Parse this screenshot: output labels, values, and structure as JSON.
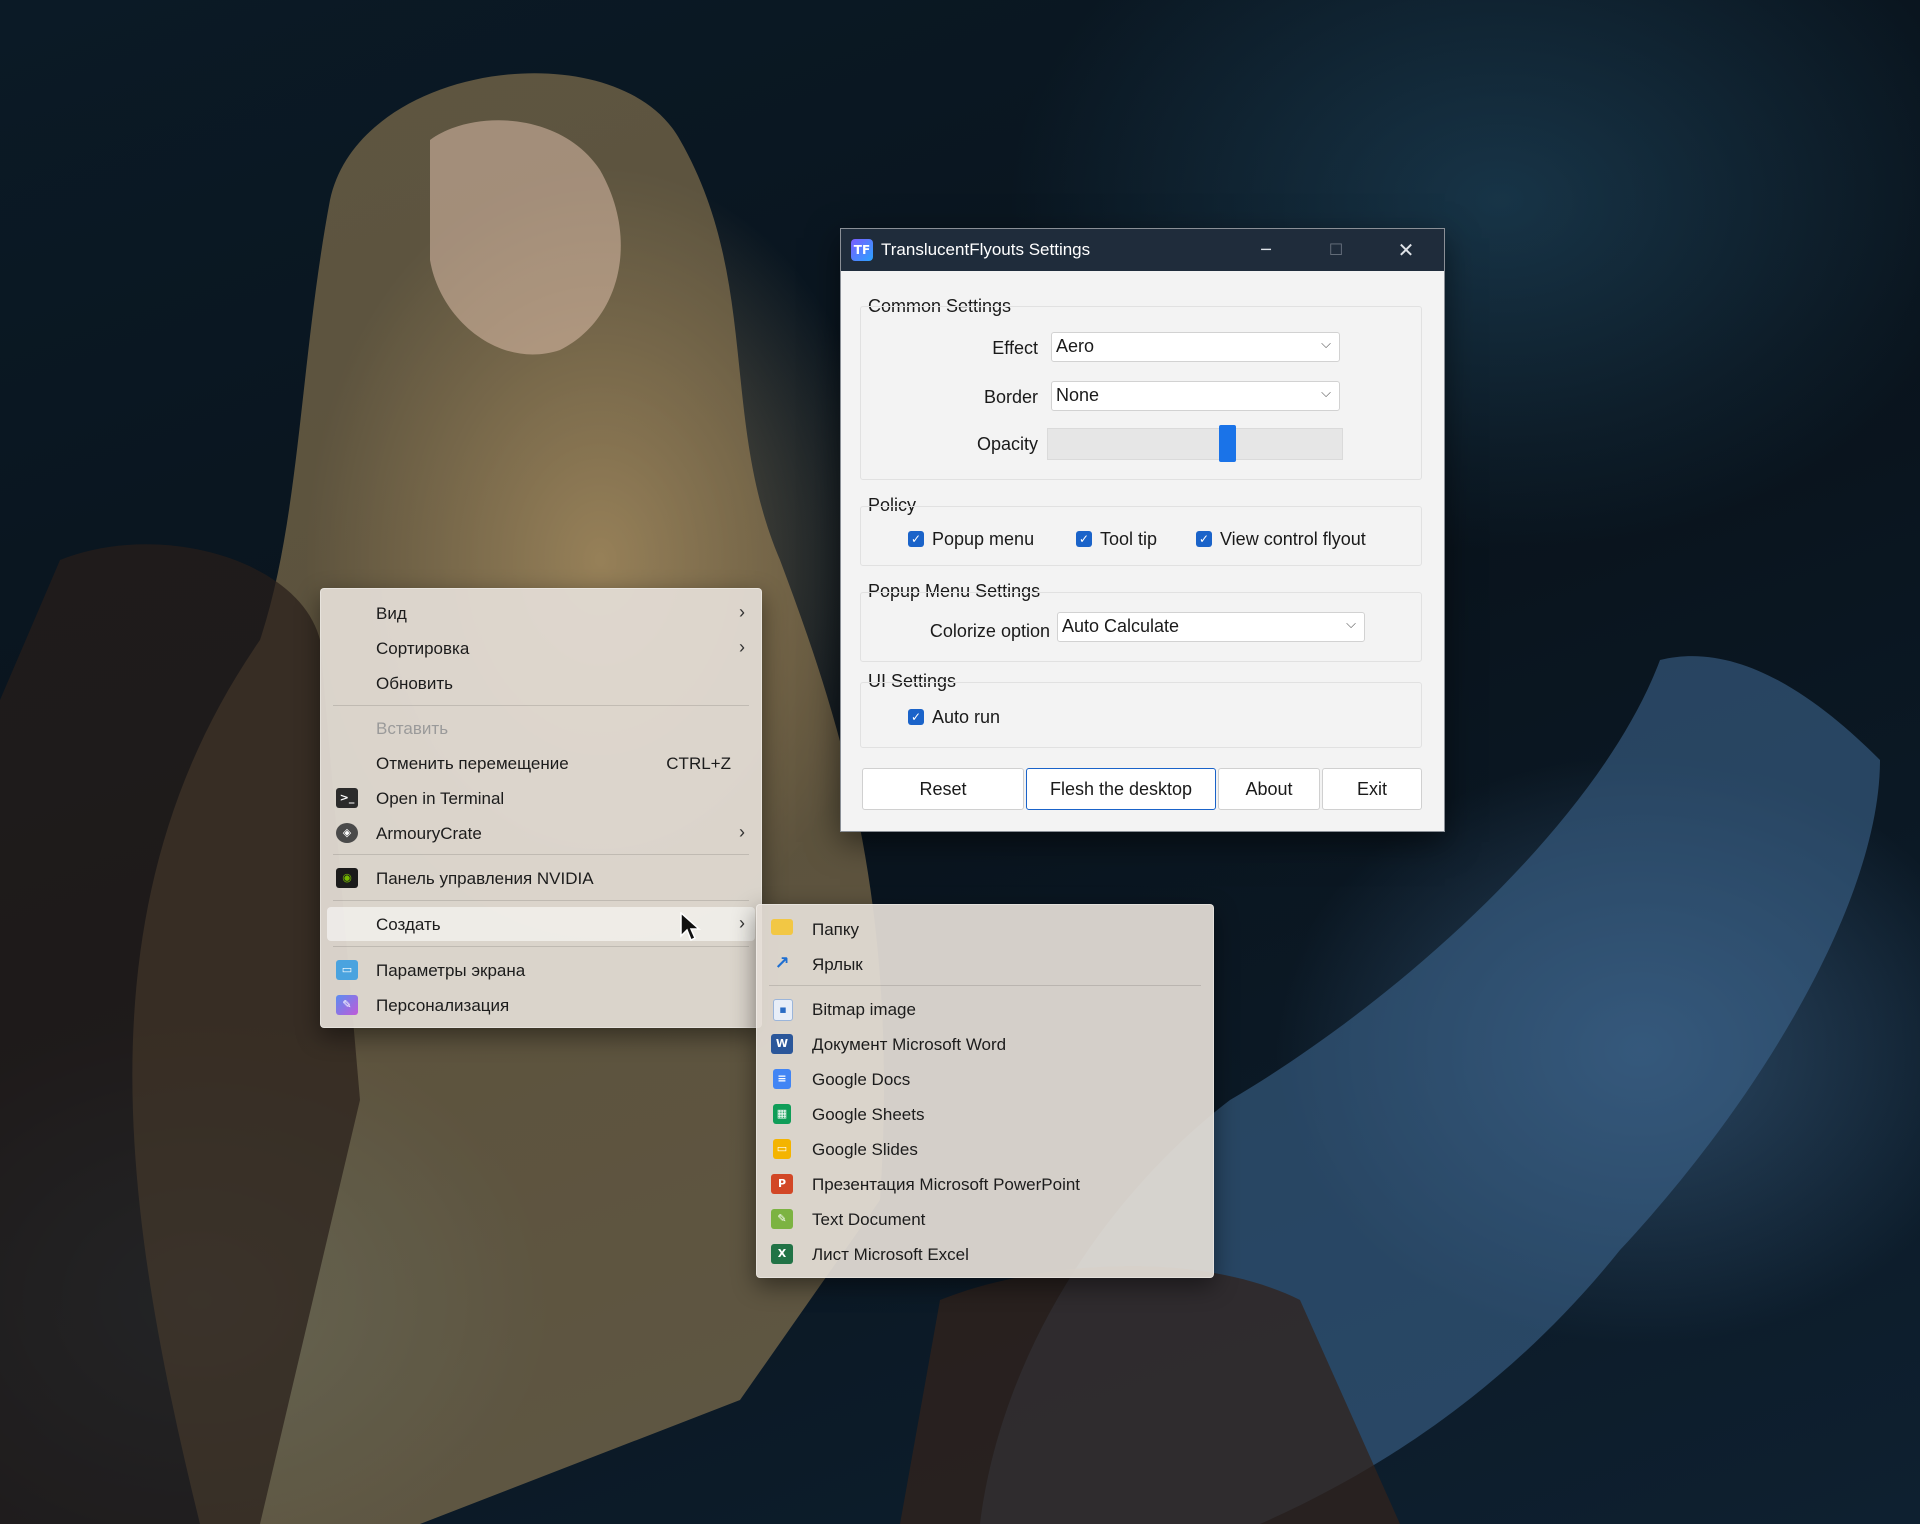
{
  "settings_window": {
    "app_icon_text": "TF",
    "title": "TranslucentFlyouts Settings",
    "minimize": "─",
    "maximize": "☐",
    "close": "✕",
    "common": {
      "title": "Common Settings",
      "effect_label": "Effect",
      "effect_value": "Aero",
      "border_label": "Border",
      "border_value": "None",
      "opacity_label": "Opacity",
      "opacity_level": 0.62
    },
    "policy": {
      "title": "Policy",
      "popup_menu": "Popup menu",
      "tool_tip": "Tool tip",
      "view_control_flyout": "View control flyout"
    },
    "popup_menu_settings": {
      "title": "Popup Menu Settings",
      "colorize_label": "Colorize option",
      "colorize_value": "Auto Calculate"
    },
    "ui_settings": {
      "title": "UI Settings",
      "auto_run": "Auto run"
    },
    "buttons": {
      "reset": "Reset",
      "flesh": "Flesh the desktop",
      "about": "About",
      "exit": "Exit"
    },
    "checkmark": "✓",
    "dropdown_arrow": "⌵"
  },
  "context_menu": {
    "submenu_arrow": "›",
    "items": {
      "view": "Вид",
      "sort": "Сортировка",
      "refresh": "Обновить",
      "paste": "Вставить",
      "undo": "Отменить перемещение",
      "undo_shortcut": "CTRL+Z",
      "terminal": "Open in Terminal",
      "armoury": "ArmouryCrate",
      "nvidia": "Панель управления NVIDIA",
      "create": "Создать",
      "display": "Параметры экрана",
      "personalize": "Персонализация"
    }
  },
  "create_submenu": {
    "folder": "Папку",
    "shortcut": "Ярлык",
    "bitmap": "Bitmap image",
    "word": "Документ Microsoft Word",
    "gdocs": "Google Docs",
    "gsheets": "Google Sheets",
    "gslides": "Google Slides",
    "powerpoint": "Презентация Microsoft PowerPoint",
    "text": "Text Document",
    "excel": "Лист Microsoft Excel"
  },
  "colors": {
    "accent": "#1a63c9",
    "title_bar": "#1f2c3b"
  }
}
